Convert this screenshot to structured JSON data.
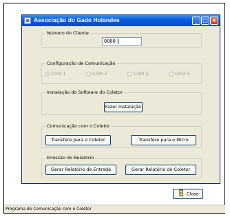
{
  "window": {
    "title": "Associação do Gado Holandes",
    "controls": {
      "minimize": "_",
      "maximize": "□",
      "close": "×"
    }
  },
  "cliente": {
    "label": "Número do Cliente",
    "value": "0000"
  },
  "comunicacao": {
    "label": "Configuração de Comunicação",
    "options": [
      "COM 1",
      "COM 2",
      "COM 3",
      "COM 4"
    ],
    "selected": "COM 1"
  },
  "instalacao": {
    "label": "Instalação do Software do Coletor",
    "button": "Fazer Instalação"
  },
  "coletor": {
    "label": "Comunicação com o Coletor",
    "to_coletor": "Transfere para o Coletor",
    "to_micro": "Transfere para o Micro"
  },
  "relatorio": {
    "label": "Emissão do Relatório",
    "entrada": "Gerar Relatório de Entrada",
    "coletor": "Gerar Relatório do Coletor"
  },
  "close_button": {
    "label": "Close",
    "icon": "door-icon"
  },
  "status": "Programa de Comunicação com o Coletor"
}
